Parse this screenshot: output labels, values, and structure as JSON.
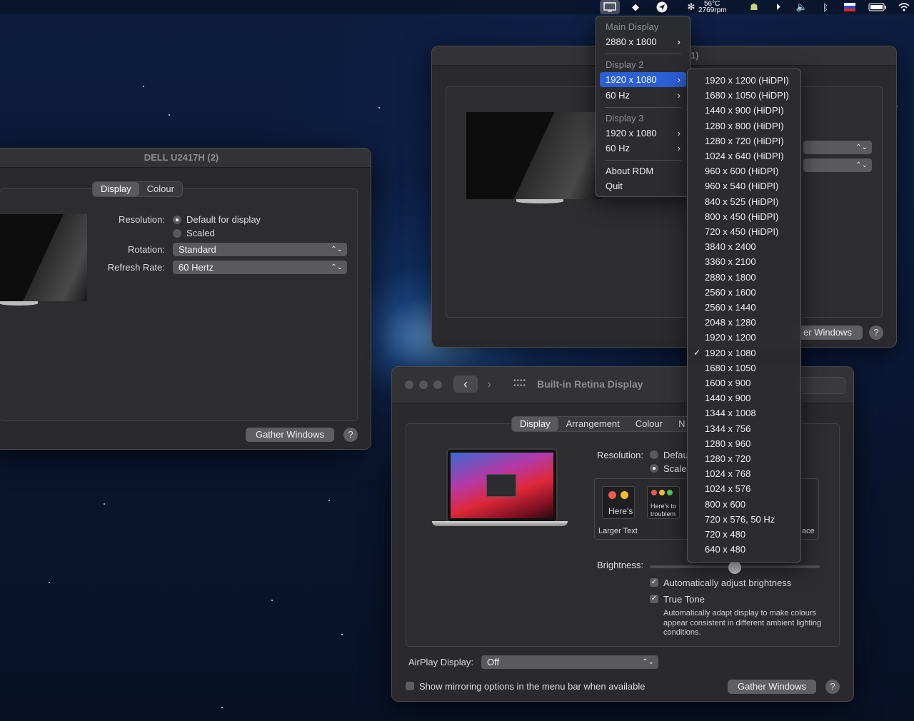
{
  "menubar": {
    "temp_line1": "56°C",
    "temp_line2": "2769rpm",
    "icons": [
      "display-icon",
      "dropbox-icon",
      "telegram-icon",
      "fan-icon",
      "android-icon",
      "play-icon",
      "volume-icon",
      "bluetooth-icon",
      "flag-icon",
      "battery-icon",
      "wifi-icon"
    ]
  },
  "rdm_menu": {
    "main_header": "Main Display",
    "main_res": "2880 x 1800",
    "d2_header": "Display 2",
    "d2_res": "1920 x 1080",
    "d2_hz": "60 Hz",
    "d3_header": "Display 3",
    "d3_res": "1920 x 1080",
    "d3_hz": "60 Hz",
    "about": "About RDM",
    "quit": "Quit"
  },
  "res_submenu": {
    "checked": "1920 x 1080",
    "items": [
      "1920 x 1200 (HiDPI)",
      "1680 x 1050 (HiDPI)",
      "1440 x 900 (HiDPI)",
      "1280 x 800 (HiDPI)",
      "1280 x 720 (HiDPI)",
      "1024 x 640 (HiDPI)",
      "960 x 600 (HiDPI)",
      "960 x 540 (HiDPI)",
      "840 x 525 (HiDPI)",
      "800 x 450 (HiDPI)",
      "720 x 450 (HiDPI)",
      "3840 x 2400",
      "3360 x 2100",
      "2880 x 1800",
      "2560 x 1600",
      "2560 x 1440",
      "2048 x 1280",
      "1920 x 1200",
      "1920 x 1080",
      "1680 x 1050",
      "1600 x 900",
      "1440 x 900",
      "1344 x 1008",
      "1344 x 756",
      "1280 x 960",
      "1280 x 720",
      "1024 x 768",
      "1024 x 576",
      "800 x 600",
      "720 x 576, 50 Hz",
      "720 x 480",
      "640 x 480"
    ]
  },
  "dell_window": {
    "title": "DELL U2417H (2)",
    "tab_display": "Display",
    "tab_colour": "Colour",
    "resolution_label": "Resolution:",
    "opt_default": "Default for display",
    "opt_scaled": "Scaled",
    "rotation_label": "Rotation:",
    "rotation_value": "Standard",
    "refresh_label": "Refresh Rate:",
    "refresh_value": "60 Hertz",
    "gather": "Gather Windows",
    "help": "?"
  },
  "back_window": {
    "title_fragment": "1)",
    "gather_fragment": "er Windows",
    "help": "?"
  },
  "retina_window": {
    "title": "Built-in Retina Display",
    "tab_display": "Display",
    "tab_arrangement": "Arrangement",
    "tab_colour": "Colour",
    "tab_n": "N",
    "resolution_label": "Resolution:",
    "opt_default": "Defau",
    "opt_scaled": "Scale",
    "thumb1_text": "Here's",
    "thumb2_text1": "Here's to",
    "thumb2_text2": "troublem",
    "larger_text": "Larger Text",
    "space_fragment": "ace",
    "brightness_label": "Brightness:",
    "brightness_value": 0.5,
    "auto_brightness": "Automatically adjust brightness",
    "true_tone": "True Tone",
    "true_tone_desc": "Automatically adapt display to make colours appear consistent in different ambient lighting conditions.",
    "airplay_label": "AirPlay Display:",
    "airplay_value": "Off",
    "mirroring": "Show mirroring options in the menu bar when available",
    "gather": "Gather Windows",
    "help": "?"
  }
}
